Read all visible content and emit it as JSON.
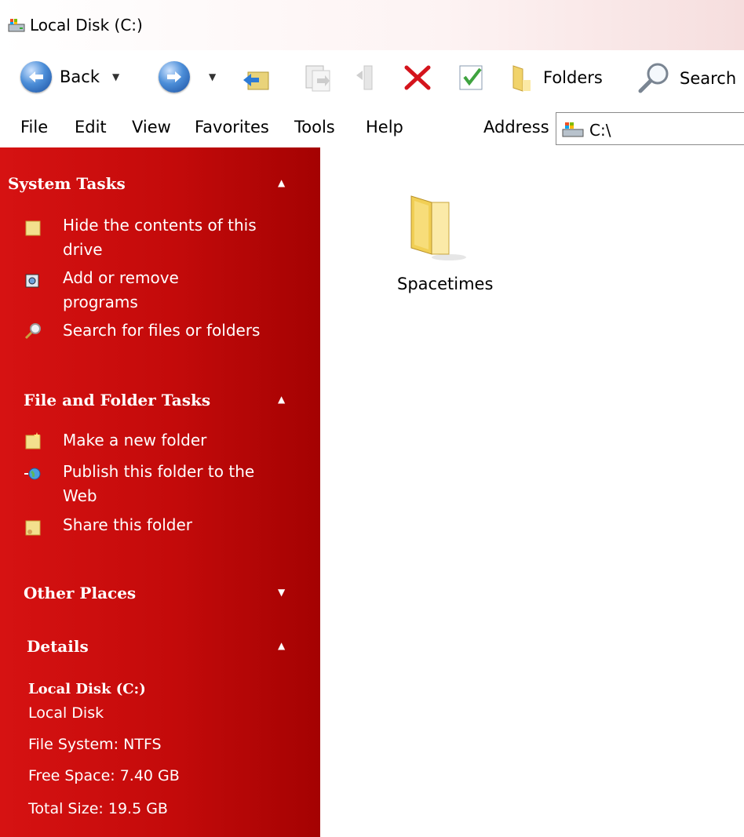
{
  "window": {
    "title": "Local Disk  (C:)"
  },
  "toolbar": {
    "back_label": "Back",
    "folders_label": "Folders",
    "search_label": "Search"
  },
  "menu": {
    "items": [
      "File",
      "Edit",
      "View",
      "Favorites",
      "Tools",
      "Help"
    ],
    "address_label": "Address",
    "address_value": "C:\\"
  },
  "sidebar": {
    "system_tasks": {
      "title": "System Tasks",
      "items": [
        [
          "Hide the contents of this",
          "drive"
        ],
        [
          "Add or remove",
          "programs"
        ],
        [
          "Search for files or folders"
        ]
      ]
    },
    "file_folder_tasks": {
      "title": "File and Folder Tasks",
      "items": [
        [
          "Make a new folder"
        ],
        [
          "Publish this folder to the",
          "Web"
        ],
        [
          "Share this folder"
        ]
      ]
    },
    "other_places": {
      "title": "Other Places"
    },
    "details": {
      "title": "Details",
      "name": "Local Disk  (C:)",
      "type": "Local Disk",
      "file_system": "File System: NTFS",
      "free_space": "Free Space: 7.40 GB",
      "total_size": "Total Size: 19.5 GB"
    }
  },
  "content": {
    "items": [
      {
        "name": "Spacetimes",
        "icon": "folder-icon"
      }
    ]
  },
  "colors": {
    "sidebar": "#c30a0a",
    "back_button": "#2f6fc4"
  }
}
